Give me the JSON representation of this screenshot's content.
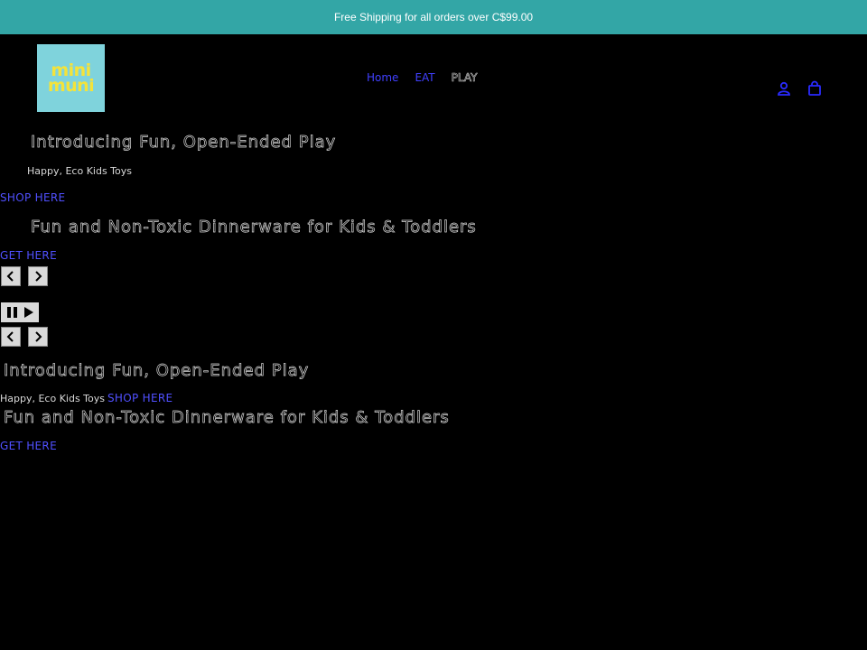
{
  "announcement": {
    "text": "Free Shipping for all orders over C$99.00"
  },
  "logo": {
    "line1": "mini",
    "line2": "muni"
  },
  "nav": {
    "items": [
      {
        "label": "Home"
      },
      {
        "label": "EAT"
      },
      {
        "label": "PLAY"
      }
    ]
  },
  "header_icons": [
    "account-icon",
    "cart-icon"
  ],
  "slideshow": {
    "slide1": {
      "heading": "Introducing Fun, Open-Ended Play",
      "subheading": "Happy, Eco Kids Toys",
      "button": "SHOP HERE"
    },
    "slide2": {
      "heading": "Fun and Non-Toxic Dinnerware for Kids & Toddlers",
      "button": "GET HERE"
    },
    "controls": {
      "prev_icon": "chevron-left-icon",
      "next_icon": "chevron-right-icon",
      "pause_icon": "pause-icon",
      "play_icon": "play-icon"
    }
  },
  "colors": {
    "announcement_bg": "#33a6a6",
    "logo_bg": "#7fd3dc",
    "logo_text": "#f4e33a",
    "link": "#5050ff",
    "page_bg": "#000000"
  }
}
